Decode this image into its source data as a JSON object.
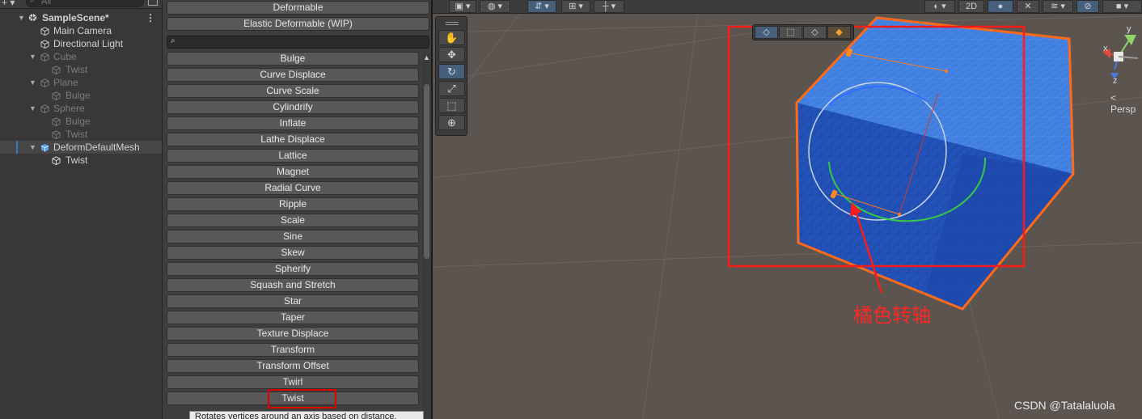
{
  "hierarchy": {
    "search_placeholder": "All",
    "items": [
      {
        "label": "SampleScene*",
        "dim": false
      },
      {
        "label": "Main Camera",
        "dim": false
      },
      {
        "label": "Directional Light",
        "dim": false
      },
      {
        "label": "Cube",
        "dim": true
      },
      {
        "label": "Twist",
        "dim": true
      },
      {
        "label": "Plane",
        "dim": true
      },
      {
        "label": "Bulge",
        "dim": true
      },
      {
        "label": "Sphere",
        "dim": true
      },
      {
        "label": "Bulge",
        "dim": true
      },
      {
        "label": "Twist",
        "dim": true
      },
      {
        "label": "DeformDefaultMesh",
        "dim": false
      },
      {
        "label": "Twist",
        "dim": false
      }
    ]
  },
  "menu": {
    "top_items": [
      "Deformable",
      "Elastic Deformable (WIP)"
    ],
    "items": [
      "Bulge",
      "Curve Displace",
      "Curve Scale",
      "Cylindrify",
      "Inflate",
      "Lathe Displace",
      "Lattice",
      "Magnet",
      "Radial Curve",
      "Ripple",
      "Scale",
      "Sine",
      "Skew",
      "Spherify",
      "Squash and Stretch",
      "Star",
      "Taper",
      "Texture Displace",
      "Transform",
      "Transform Offset",
      "Twirl",
      "Twist"
    ],
    "tooltip": "Rotates vertices around an axis based on distance."
  },
  "toolbar": {
    "mode_2d": "2D"
  },
  "gizmo": {
    "y_label": "y",
    "x_label": "x",
    "z_label": "z",
    "persp_label": "< Persp"
  },
  "annotation": {
    "text": "橘色转轴",
    "color": "#ff2626"
  },
  "watermark": "CSDN @Tatalaluola",
  "colors": {
    "selection_outline": "#ff6a1a",
    "cube_top": "#3f7fe0",
    "cube_front": "#2352b8",
    "scene_bg": "#5c554f"
  }
}
